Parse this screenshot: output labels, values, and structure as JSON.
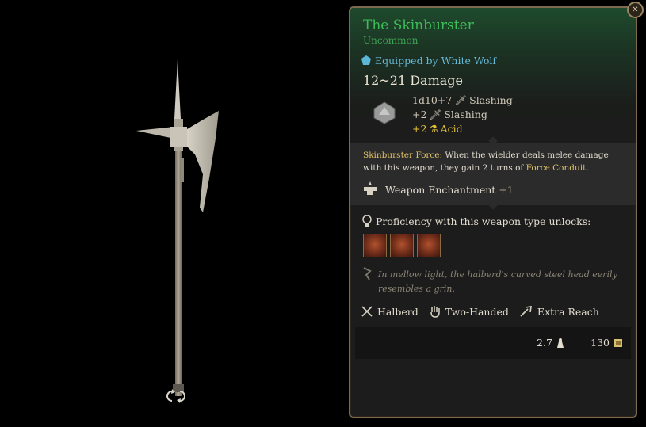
{
  "item": {
    "name": "The Skinburster",
    "rarity": "Uncommon",
    "equipped_by": "Equipped by White Wolf",
    "damage_range": "12~21 Damage",
    "damage_lines": [
      {
        "value": "1d10+7",
        "type": "Slashing"
      },
      {
        "value": "+2",
        "type": "Slashing"
      },
      {
        "value": "+2",
        "type": "Acid"
      }
    ]
  },
  "enchantment": {
    "name_label": "Skinburster Force:",
    "text_before": " When the wielder deals melee damage with this weapon, they gain 2 turns of ",
    "highlight": "Force Conduit",
    "text_after": ".",
    "label": "Weapon Enchantment",
    "bonus": "+1"
  },
  "proficiency": {
    "label": "Proficiency with this weapon type unlocks:"
  },
  "flavor": "In mellow light, the halberd's curved steel head eerily resembles a grin.",
  "properties": [
    {
      "label": "Halberd",
      "icon": "crossed-weapons-icon"
    },
    {
      "label": "Two-Handed",
      "icon": "hand-icon"
    },
    {
      "label": "Extra Reach",
      "icon": "reach-icon"
    }
  ],
  "footer": {
    "weight": "2.7",
    "value": "130"
  },
  "colors": {
    "title": "#3dbd57",
    "equipped": "#66b8d6",
    "acid": "#e0c338",
    "border": "#7d6a4e"
  }
}
